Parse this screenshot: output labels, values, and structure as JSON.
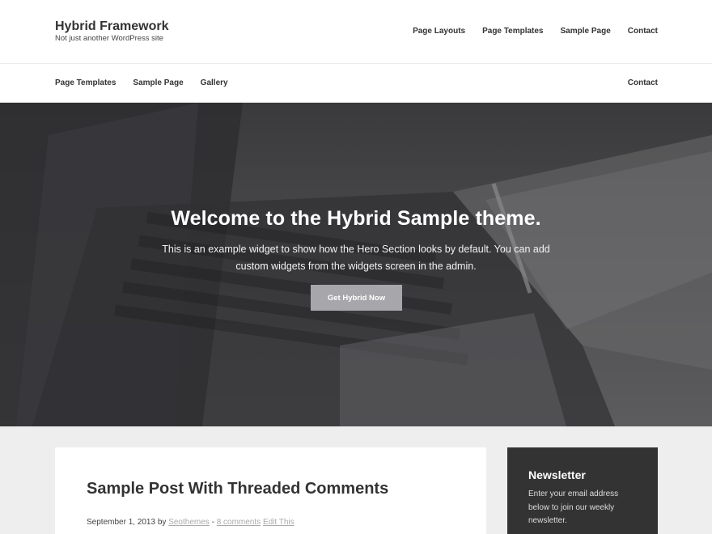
{
  "site": {
    "title": "Hybrid Framework",
    "description": "Not just another WordPress site"
  },
  "primary_nav": {
    "items": [
      {
        "label": "Page Layouts"
      },
      {
        "label": "Page Templates"
      },
      {
        "label": "Sample Page"
      },
      {
        "label": "Contact"
      }
    ]
  },
  "secondary_nav": {
    "left_items": [
      {
        "label": "Page Templates"
      },
      {
        "label": "Sample Page"
      },
      {
        "label": "Gallery"
      }
    ],
    "right_item": {
      "label": "Contact"
    }
  },
  "hero": {
    "title": "Welcome to the Hybrid Sample theme.",
    "text": "This is an example widget to show how the Hero Section looks by default. You can add custom widgets from the widgets screen in the admin.",
    "button_label": "Get Hybrid Now"
  },
  "post": {
    "title": "Sample Post With Threaded Comments",
    "date": "September 1, 2013",
    "by": "by",
    "author": "Seothemes",
    "separator": "-",
    "comments": "8 comments",
    "edit": "Edit This"
  },
  "newsletter": {
    "title": "Newsletter",
    "text": "Enter your email address below to join our weekly newsletter."
  },
  "colors": {
    "header_bg": "#ffffff",
    "body_bg": "#eeeeee",
    "widget_bg": "#333333",
    "button_bg": "#a6a6ab"
  }
}
